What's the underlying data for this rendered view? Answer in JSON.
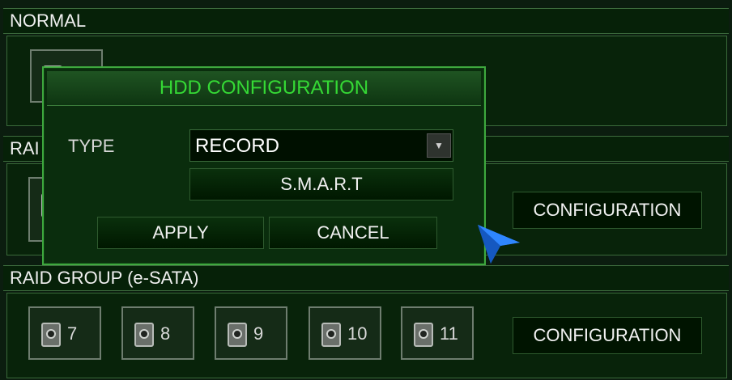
{
  "sections": {
    "normal": "NORMAL",
    "raid_partial": "RAI",
    "raid_esata": "RAID GROUP (e-SATA)"
  },
  "raid_esata_drives": [
    {
      "number": "7"
    },
    {
      "number": "8"
    },
    {
      "number": "9"
    },
    {
      "number": "10"
    },
    {
      "number": "11"
    }
  ],
  "configuration_button_label": "CONFIGURATION",
  "dialog": {
    "title": "HDD CONFIGURATION",
    "type_label": "TYPE",
    "type_value": "RECORD",
    "smart_button": "S.M.A.R.T",
    "apply_button": "APPLY",
    "cancel_button": "CANCEL"
  },
  "icons": {
    "hdd": "hard-drive-icon",
    "dropdown": "chevron-down-icon",
    "cursor": "mouse-pointer-icon"
  },
  "colors": {
    "background": "#0b1d0f",
    "dialog_border": "#3ea83e",
    "dialog_title": "#35d935",
    "cursor": "#1f6fe0"
  }
}
